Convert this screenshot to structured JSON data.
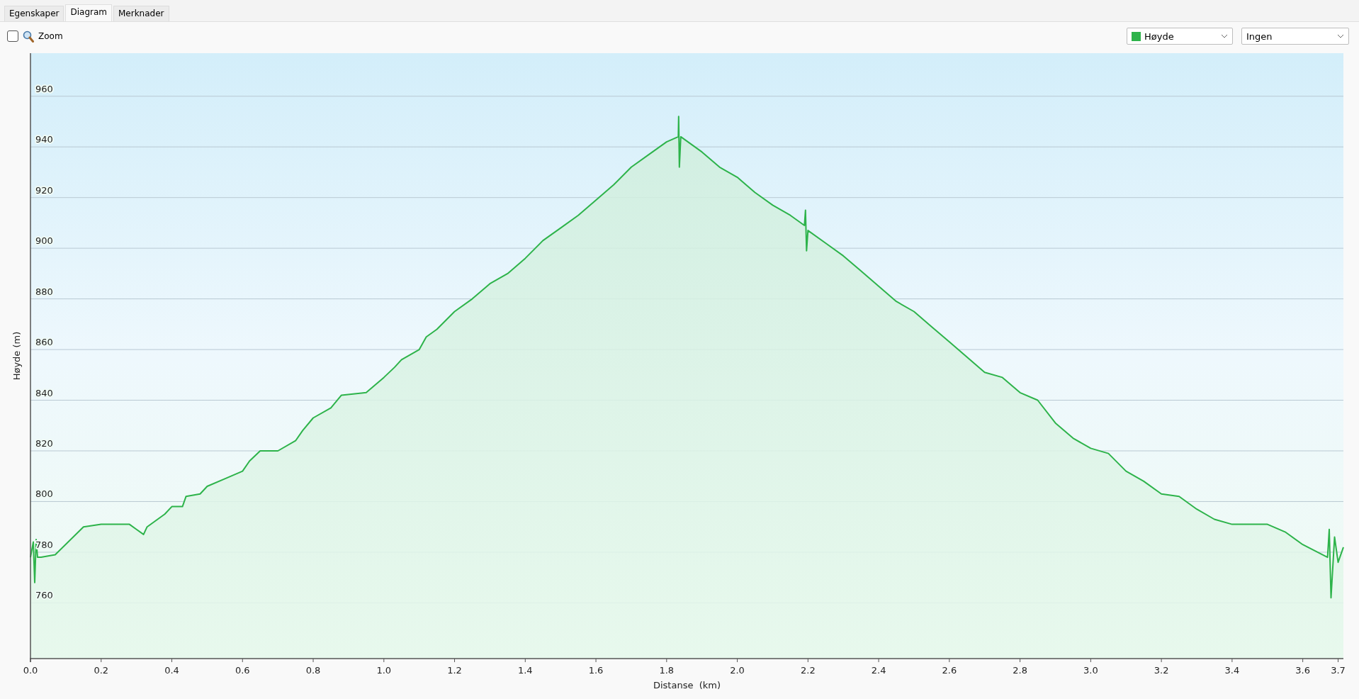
{
  "tabs": [
    {
      "label": "Egenskaper",
      "selected": false
    },
    {
      "label": "Diagram",
      "selected": true
    },
    {
      "label": "Merknader",
      "selected": false
    }
  ],
  "toolbar": {
    "zoom": {
      "label": "Zoom",
      "checked": false
    },
    "dropdowns": [
      {
        "kind": "series"
      },
      {
        "kind": "plain",
        "value": "Ingen"
      }
    ]
  },
  "chart_data": {
    "type": "area",
    "grid": true,
    "xlabel": "Distanse  (km)",
    "ylabel": "Høyde (m)",
    "xlim": [
      0,
      3.715
    ],
    "ylim": [
      738,
      977
    ],
    "xticks": [
      {
        "value": 0,
        "label": "0.0"
      },
      {
        "value": 0.2,
        "label": "0.2"
      },
      {
        "value": 0.4,
        "label": "0.4"
      },
      {
        "value": 0.6,
        "label": "0.6"
      },
      {
        "value": 0.8,
        "label": "0.8"
      },
      {
        "value": 1.0,
        "label": "1.0"
      },
      {
        "value": 1.2,
        "label": "1.2"
      },
      {
        "value": 1.4,
        "label": "1.4"
      },
      {
        "value": 1.6,
        "label": "1.6"
      },
      {
        "value": 1.8,
        "label": "1.8"
      },
      {
        "value": 2.0,
        "label": "2.0"
      },
      {
        "value": 2.2,
        "label": "2.2"
      },
      {
        "value": 2.4,
        "label": "2.4"
      },
      {
        "value": 2.6,
        "label": "2.6"
      },
      {
        "value": 2.8,
        "label": "2.8"
      },
      {
        "value": 3.0,
        "label": "3.0"
      },
      {
        "value": 3.2,
        "label": "3.2"
      },
      {
        "value": 3.4,
        "label": "3.4"
      },
      {
        "value": 3.6,
        "label": "3.6"
      },
      {
        "value": 3.7,
        "label": "3.7"
      }
    ],
    "yticks": [
      760,
      780,
      800,
      820,
      840,
      860,
      880,
      900,
      920,
      940,
      960
    ],
    "x": [
      0,
      0.008,
      0.012,
      0.016,
      0.02,
      0.03,
      0.07,
      0.15,
      0.2,
      0.28,
      0.3,
      0.32,
      0.33,
      0.38,
      0.4,
      0.43,
      0.44,
      0.48,
      0.5,
      0.55,
      0.6,
      0.62,
      0.65,
      0.7,
      0.75,
      0.77,
      0.8,
      0.85,
      0.88,
      0.95,
      1.0,
      1.03,
      1.05,
      1.1,
      1.12,
      1.15,
      1.2,
      1.25,
      1.3,
      1.35,
      1.4,
      1.45,
      1.5,
      1.55,
      1.6,
      1.65,
      1.7,
      1.75,
      1.8,
      1.833,
      1.834,
      1.836,
      1.84,
      1.9,
      1.95,
      2.0,
      2.05,
      2.1,
      2.15,
      2.19,
      2.193,
      2.196,
      2.2,
      2.25,
      2.3,
      2.35,
      2.4,
      2.45,
      2.5,
      2.55,
      2.6,
      2.65,
      2.7,
      2.75,
      2.8,
      2.85,
      2.9,
      2.95,
      3.0,
      3.05,
      3.1,
      3.15,
      3.2,
      3.25,
      3.3,
      3.35,
      3.4,
      3.5,
      3.55,
      3.6,
      3.67,
      3.675,
      3.68,
      3.69,
      3.7,
      3.715
    ],
    "series": [
      {
        "name": "Høyde",
        "color": "#2db34a",
        "values": [
          778,
          784,
          768,
          785,
          778,
          778,
          779,
          790,
          791,
          791,
          789,
          787,
          790,
          795,
          798,
          798,
          802,
          803,
          806,
          809,
          812,
          816,
          820,
          820,
          824,
          828,
          833,
          837,
          842,
          843,
          849,
          853,
          856,
          860,
          865,
          868,
          875,
          880,
          886,
          890,
          896,
          903,
          908,
          913,
          919,
          925,
          932,
          937,
          942,
          944,
          952,
          932,
          944,
          938,
          932,
          928,
          922,
          917,
          913,
          909,
          915,
          899,
          907,
          902,
          897,
          891,
          885,
          879,
          875,
          869,
          863,
          857,
          851,
          849,
          843,
          840,
          831,
          825,
          821,
          819,
          812,
          808,
          803,
          802,
          797,
          793,
          791,
          791,
          788,
          783,
          778,
          789,
          762,
          786,
          776,
          782
        ]
      }
    ]
  }
}
